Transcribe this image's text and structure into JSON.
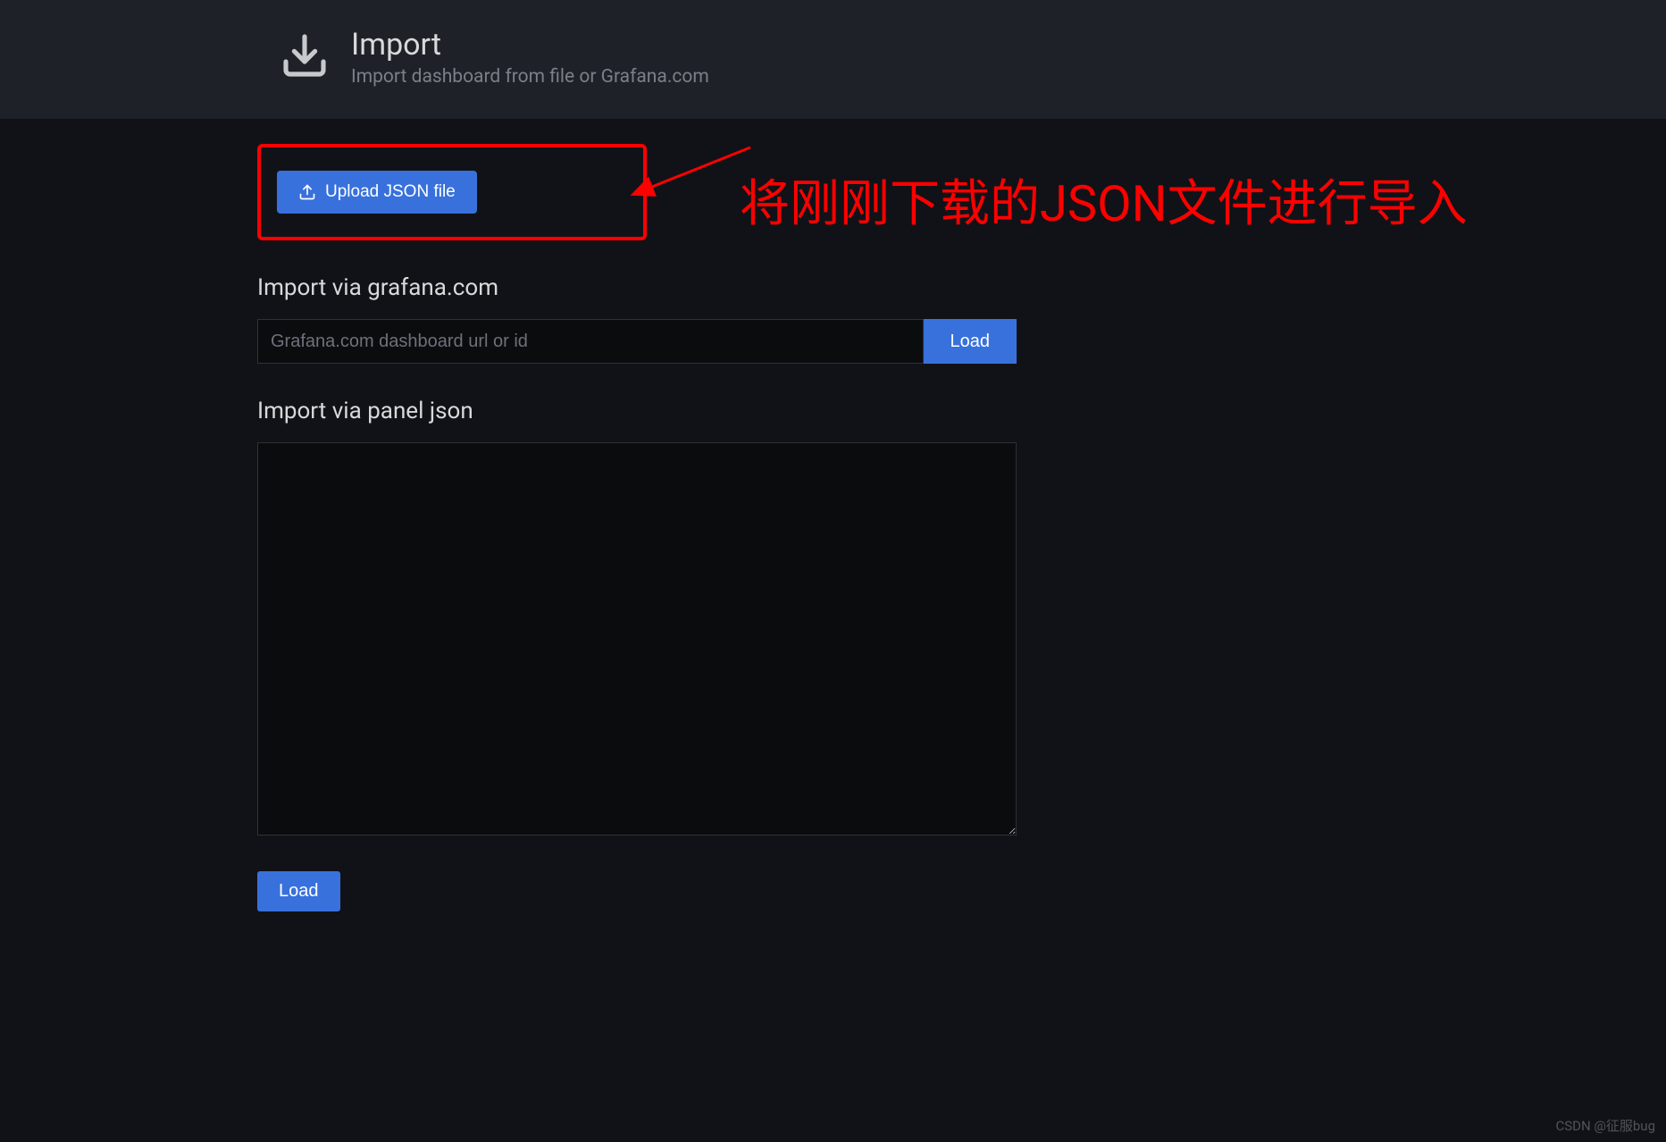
{
  "header": {
    "title": "Import",
    "subtitle": "Import dashboard from file or Grafana.com"
  },
  "upload": {
    "button_label": "Upload JSON file"
  },
  "sections": {
    "grafana_label": "Import via grafana.com",
    "grafana_placeholder": "Grafana.com dashboard url or id",
    "grafana_load": "Load",
    "panel_json_label": "Import via panel json",
    "load_button": "Load"
  },
  "annotation": {
    "text": "将刚刚下载的JSON文件进行导入"
  },
  "watermark": "CSDN @征服bug"
}
